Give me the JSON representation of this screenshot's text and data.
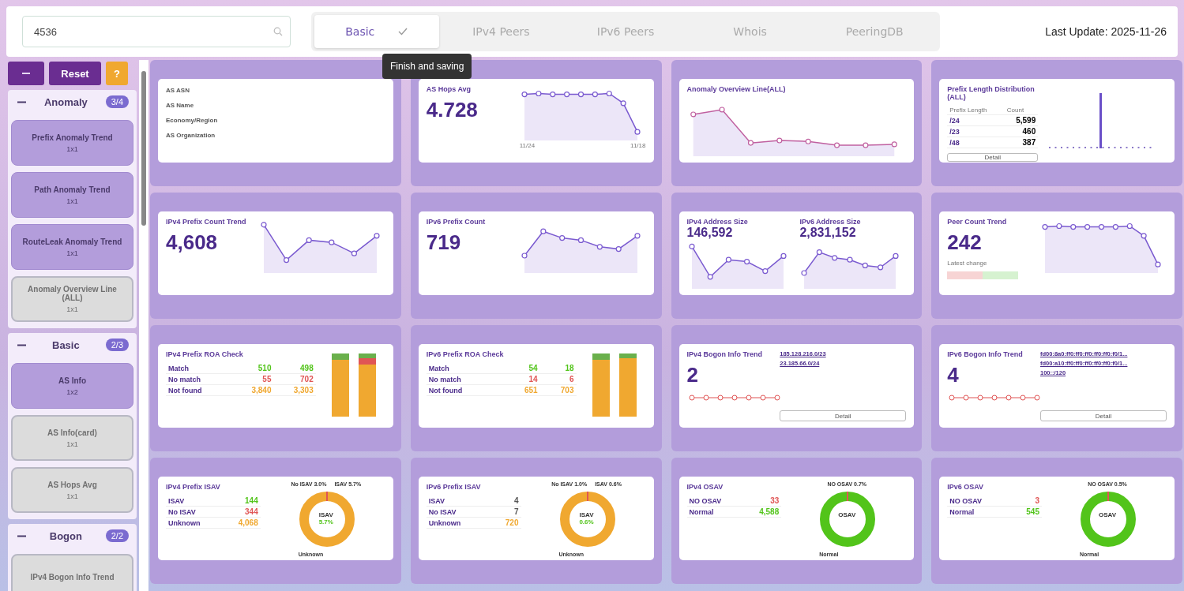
{
  "search": {
    "value": "4536"
  },
  "tabs": [
    {
      "label": "Basic",
      "selected": true,
      "done": true
    },
    {
      "label": "IPv4 Peers",
      "selected": false,
      "done": false
    },
    {
      "label": "IPv6 Peers",
      "selected": false,
      "done": false
    },
    {
      "label": "Whois",
      "selected": false,
      "done": false
    },
    {
      "label": "PeeringDB",
      "selected": false,
      "done": false
    }
  ],
  "tooltip": "Finish and saving",
  "last_update": "Last Update: 2025-11-26",
  "sidebar": {
    "buttons": [
      {
        "kind": "collapse"
      },
      {
        "kind": "reset",
        "label": "Reset"
      },
      {
        "kind": "help",
        "label": "?"
      }
    ],
    "groups": [
      {
        "name": "Anomaly",
        "count": "3/4",
        "expanded": true,
        "items": [
          {
            "title": "Prefix Anomaly Trend",
            "size": "1x1",
            "active": true
          },
          {
            "title": "Path Anomaly Trend",
            "size": "1x1",
            "active": true
          },
          {
            "title": "RouteLeak Anomaly Trend",
            "size": "1x1",
            "active": true
          },
          {
            "title": "Anomaly Overview Line (ALL)",
            "size": "1x1",
            "active": false
          }
        ]
      },
      {
        "name": "Basic",
        "count": "2/3",
        "expanded": true,
        "items": [
          {
            "title": "AS Info",
            "size": "1x2",
            "active": true
          },
          {
            "title": "AS Info(card)",
            "size": "1x1",
            "active": false
          },
          {
            "title": "AS Hops Avg",
            "size": "1x1",
            "active": false
          }
        ]
      },
      {
        "name": "Bogon",
        "count": "2/2",
        "expanded": true,
        "items": [
          {
            "title": "IPv4 Bogon Info Trend",
            "active": false
          }
        ]
      }
    ]
  },
  "cards": [
    {
      "kind": "info",
      "labels": [
        "AS ASN",
        "AS Name",
        "Economy/Region",
        "AS Organization"
      ]
    },
    {
      "kind": "metric",
      "title": "AS Hops Avg",
      "value": "4.728",
      "x_labels": [
        "11/24",
        "11/18"
      ]
    },
    {
      "kind": "line",
      "title": "Anomaly Overview Line(ALL)"
    },
    {
      "kind": "prefix",
      "title": "Prefix Length Distribution (ALL)",
      "columns": [
        "Prefix Length",
        "Count"
      ],
      "rows": [
        [
          "/24",
          "5,599"
        ],
        [
          "/23",
          "460"
        ],
        [
          "/48",
          "387"
        ]
      ],
      "button": "Detail"
    },
    {
      "kind": "metric",
      "title": "IPv4 Prefix Count Trend",
      "value": "4,608"
    },
    {
      "kind": "metric",
      "title": "IPv6 Prefix Count",
      "value": "719"
    },
    {
      "kind": "dual",
      "parts": [
        {
          "title": "IPv4 Address Size",
          "value": "146,592"
        },
        {
          "title": "IPv6 Address Size",
          "value": "2,831,152"
        }
      ]
    },
    {
      "kind": "metric",
      "title": "Peer Count Trend",
      "value": "242",
      "note": "Latest change"
    },
    {
      "kind": "rpki",
      "title": "IPv4 Prefix ROA Check",
      "rows": [
        {
          "label": "Match",
          "own": "510",
          "global": "498",
          "color": "#52c41a"
        },
        {
          "label": "No match",
          "own": "55",
          "global": "702",
          "color": "#e05555"
        },
        {
          "label": "Not found",
          "own": "3,840",
          "global": "3,303",
          "color": "#f0a830"
        }
      ]
    },
    {
      "kind": "rpki",
      "title": "IPv6 Prefix ROA Check",
      "rows": [
        {
          "label": "Match",
          "own": "54",
          "global": "18",
          "color": "#52c41a"
        },
        {
          "label": "No match",
          "own": "14",
          "global": "6",
          "color": "#e05555"
        },
        {
          "label": "Not found",
          "own": "651",
          "global": "703",
          "color": "#f0a830"
        }
      ]
    },
    {
      "kind": "bogon",
      "title": "IPv4 Bogon Info Trend",
      "value": "2",
      "links": [
        "185.128.216.0/23",
        "23.185.66.0/24"
      ],
      "button": "Detail"
    },
    {
      "kind": "bogon",
      "title": "IPv6 Bogon Info Trend",
      "value": "4",
      "links": [
        "fd00:8a0:ff0:ff0:ff0:ff0:ff0:f0/1...",
        "fd00:a10:ff0:ff0:ff0:ff0:ff0:f0/1...",
        "100::/120"
      ],
      "button": "Detail"
    },
    {
      "kind": "sav",
      "title": "IPv4 Prefix ISAV",
      "color": "#f0a830",
      "rows": [
        {
          "label": "ISAV",
          "value": "144",
          "color": "#52c41a"
        },
        {
          "label": "No ISAV",
          "value": "344",
          "color": "#e05555"
        },
        {
          "label": "Unknown",
          "value": "4,068",
          "color": "#f0a830"
        }
      ],
      "top_labels": [
        "No ISAV 3.0%",
        "ISAV 5.7%"
      ],
      "center": [
        "ISAV",
        "5.7%"
      ],
      "bottom_label": "Unknown"
    },
    {
      "kind": "sav",
      "title": "IPv6 Prefix ISAV",
      "color": "#f0a830",
      "rows": [
        {
          "label": "ISAV",
          "value": "4",
          "color": "#555555"
        },
        {
          "label": "No ISAV",
          "value": "7",
          "color": "#555555"
        },
        {
          "label": "Unknown",
          "value": "720",
          "color": "#f0a830"
        }
      ],
      "top_labels": [
        "No ISAV 1.0%",
        "ISAV 0.6%"
      ],
      "center": [
        "ISAV",
        "0.6%"
      ],
      "bottom_label": "Unknown"
    },
    {
      "kind": "sav",
      "title": "IPv4 OSAV",
      "color": "#52c41a",
      "rows": [
        {
          "label": "NO OSAV",
          "value": "33",
          "color": "#e05555"
        },
        {
          "label": "Normal",
          "value": "4,588",
          "color": "#52c41a"
        }
      ],
      "top_labels": [
        "NO OSAV 0.7%"
      ],
      "center": [
        "OSAV"
      ],
      "bottom_label": "Normal"
    },
    {
      "kind": "sav",
      "title": "IPv6 OSAV",
      "color": "#52c41a",
      "rows": [
        {
          "label": "NO OSAV",
          "value": "3",
          "color": "#e05555"
        },
        {
          "label": "Normal",
          "value": "545",
          "color": "#52c41a"
        }
      ],
      "top_labels": [
        "NO OSAV 0.5%"
      ],
      "center": [
        "OSAV"
      ],
      "bottom_label": "Normal"
    }
  ]
}
